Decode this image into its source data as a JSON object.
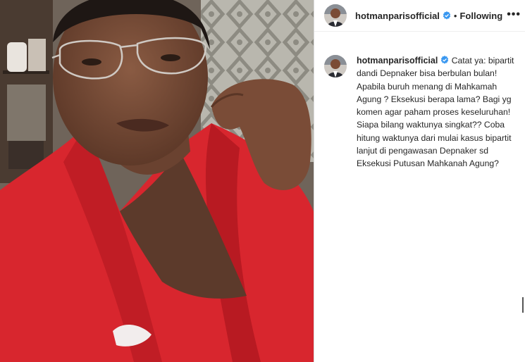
{
  "post": {
    "username": "hotmanparisofficial",
    "follow_status": "Following",
    "separator": "•",
    "more_label": "•••",
    "caption": "Catat ya: bipartit dandi Depnaker bisa berbulan bulan! Apabila buruh menang di Mahkamah Agung ? Eksekusi berapa lama? Bagi yg komen agar paham proses keseluruhan! Siapa bilang waktunya singkat?? Coba hitung waktunya dari mulai kasus bipartit lanjut di pengawasan Depnaker sd Eksekusi Putusan Mahkanah Agung?"
  },
  "icons": {
    "verified": "verified-badge-icon",
    "more": "more-options-icon"
  },
  "colors": {
    "verified_blue": "#3897f0",
    "robe_red": "#d8262e",
    "text": "#262626"
  }
}
